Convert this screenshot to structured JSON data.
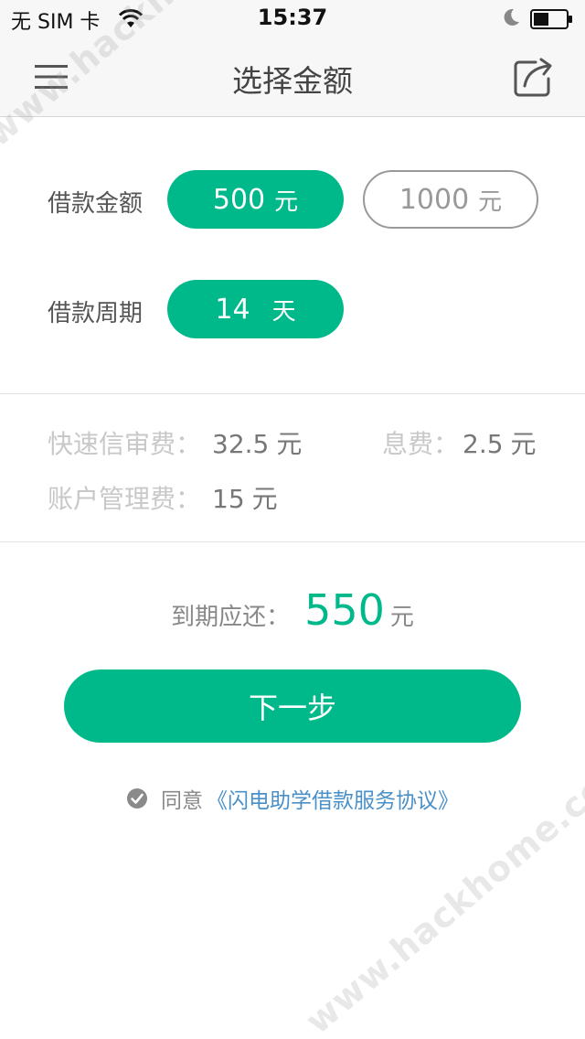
{
  "status_bar": {
    "carrier": "无 SIM 卡",
    "time": "15:37"
  },
  "nav": {
    "title": "选择金额"
  },
  "loan_amount": {
    "label": "借款金额",
    "options": [
      {
        "value": "500",
        "unit": "元",
        "selected": true
      },
      {
        "value": "1000",
        "unit": "元",
        "selected": false
      }
    ]
  },
  "loan_period": {
    "label": "借款周期",
    "options": [
      {
        "value": "14",
        "unit": "天",
        "selected": true
      }
    ]
  },
  "fees": {
    "review": {
      "label": "快速信审费：",
      "value": "32.5",
      "unit": "元"
    },
    "interest": {
      "label": "息费：",
      "value": "2.5",
      "unit": "元"
    },
    "management": {
      "label": "账户管理费：",
      "value": "15",
      "unit": "元"
    }
  },
  "total": {
    "label": "到期应还：",
    "amount": "550",
    "unit": "元"
  },
  "next_button": {
    "label": "下一步"
  },
  "agreement": {
    "prefix": "同意",
    "link": "《闪电助学借款服务协议》"
  },
  "watermark": {
    "text": "www.hackhome.com"
  },
  "colors": {
    "accent": "#00b98b",
    "link": "#4a90c8"
  }
}
